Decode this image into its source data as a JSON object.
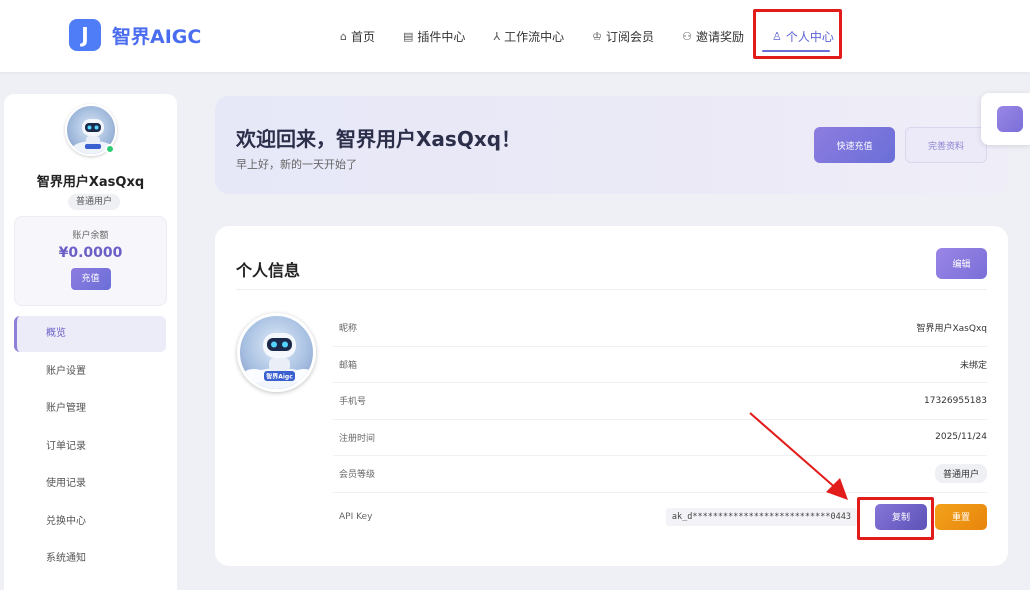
{
  "app": {
    "logo_letter": "J",
    "brand_name": "智界AIGC"
  },
  "nav": {
    "items": [
      {
        "icon": "⌂",
        "label": "首页"
      },
      {
        "icon": "▤",
        "label": "插件中心"
      },
      {
        "icon": "⅄",
        "label": "工作流中心"
      },
      {
        "icon": "♔",
        "label": "订阅会员"
      },
      {
        "icon": "⚇",
        "label": "邀请奖励"
      },
      {
        "icon": "♙",
        "label": "个人中心"
      }
    ],
    "active_index": 5
  },
  "sidebar": {
    "username": "智界用户XasQxq",
    "user_tag": "普通用户",
    "balance_label": "账户余额",
    "balance_value": "¥0.0000",
    "recharge_label": "充值",
    "menu": [
      "概览",
      "账户设置",
      "账户管理",
      "订单记录",
      "使用记录",
      "兑换中心",
      "系统通知"
    ],
    "active_menu_index": 0
  },
  "welcome": {
    "title": "欢迎回来，智界用户XasQxq！",
    "subtitle": "早上好，新的一天开始了",
    "quick_recharge_label": "快速充值",
    "complete_profile_label": "完善资料"
  },
  "profile": {
    "title": "个人信息",
    "edit_label": "编辑",
    "avatar_caption": "智界Aigc",
    "fields": [
      {
        "label": "昵称",
        "value": "智界用户XasQxq"
      },
      {
        "label": "邮箱",
        "value": "未绑定"
      },
      {
        "label": "手机号",
        "value": "17326955183"
      },
      {
        "label": "注册时间",
        "value": "2025/11/24"
      },
      {
        "label": "会员等级",
        "value": "普通用户"
      }
    ],
    "api_key_label": "API Key",
    "api_key_value": "ak_d***************************0443",
    "copy_label": "复制",
    "reset_label": "重置"
  },
  "colors": {
    "accent": "#6a6fd8",
    "highlight": "#e21b1b",
    "reset": "#e8850b"
  }
}
